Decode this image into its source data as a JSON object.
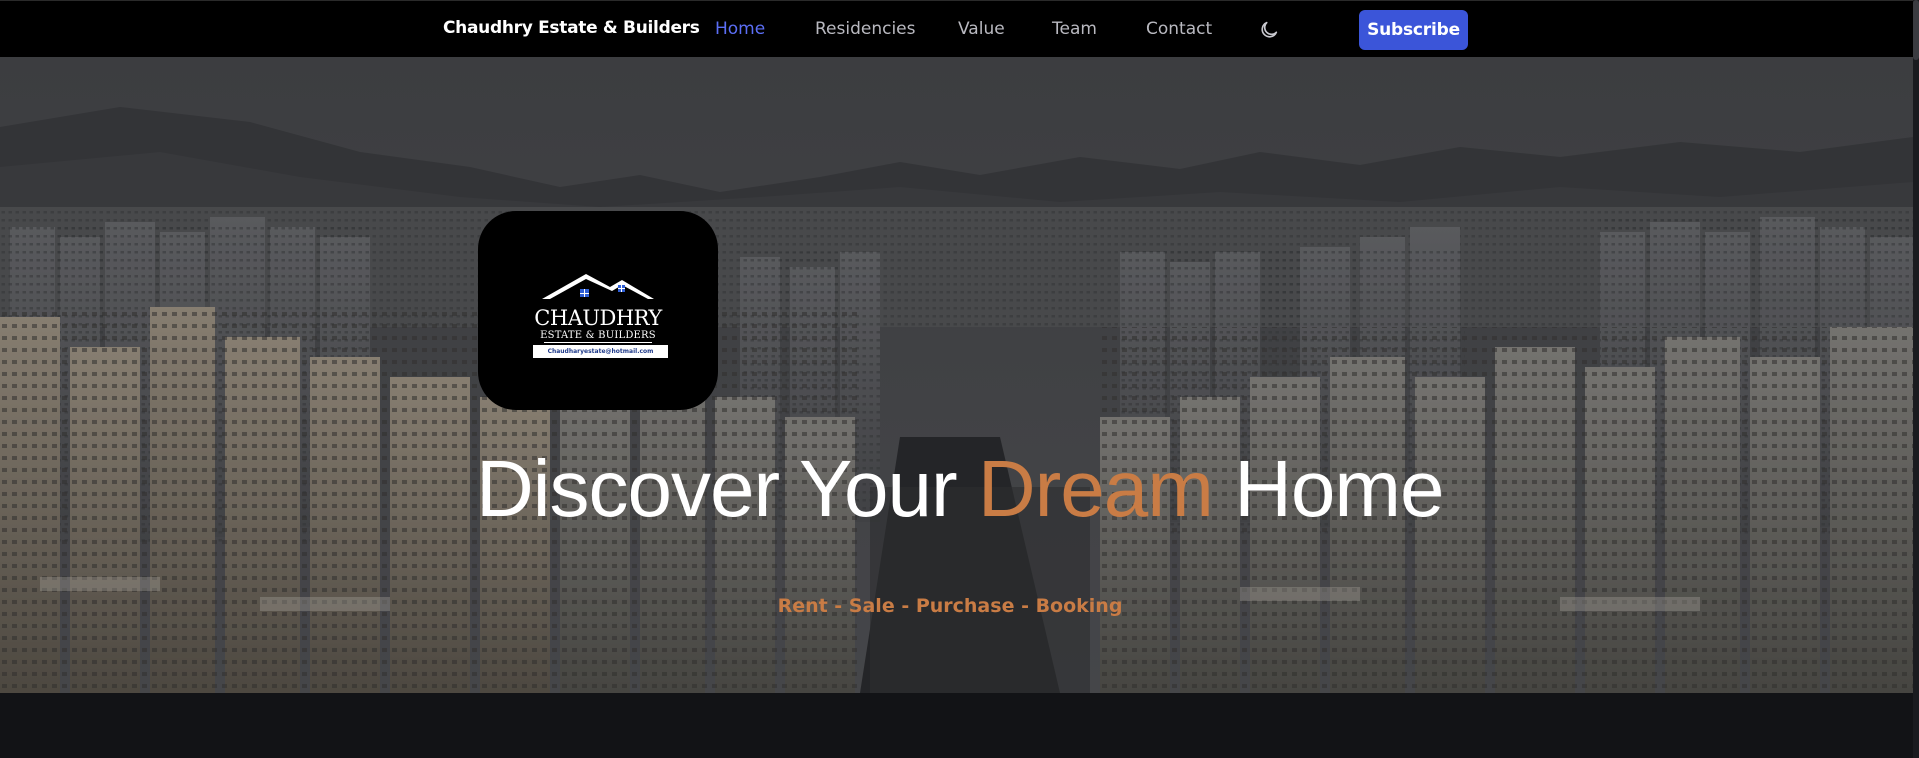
{
  "navbar": {
    "brand": "Chaudhry Estate & Builders",
    "links": [
      {
        "label": "Home",
        "active": true
      },
      {
        "label": "Residencies",
        "active": false
      },
      {
        "label": "Value",
        "active": false
      },
      {
        "label": "Team",
        "active": false
      },
      {
        "label": "Contact",
        "active": false
      }
    ],
    "theme_toggle_icon": "moon-icon",
    "subscribe_label": "Subscribe"
  },
  "hero": {
    "logo": {
      "name": "CHAUDHRY",
      "sub": "ESTATE & BUILDERS",
      "email": "Chaudharyestate@hotmail.com"
    },
    "title_part1": "Discover Your ",
    "title_accent": "Dream",
    "title_part2": " Home",
    "subtitle": "Rent - Sale - Purchase - Booking",
    "background": "aerial city skyline with apartment towers"
  },
  "colors": {
    "accent": "#c97c45",
    "link_active": "#5b6ef5",
    "button": "#3b55d9",
    "navbar_bg": "#000000",
    "page_bg": "#121316"
  }
}
